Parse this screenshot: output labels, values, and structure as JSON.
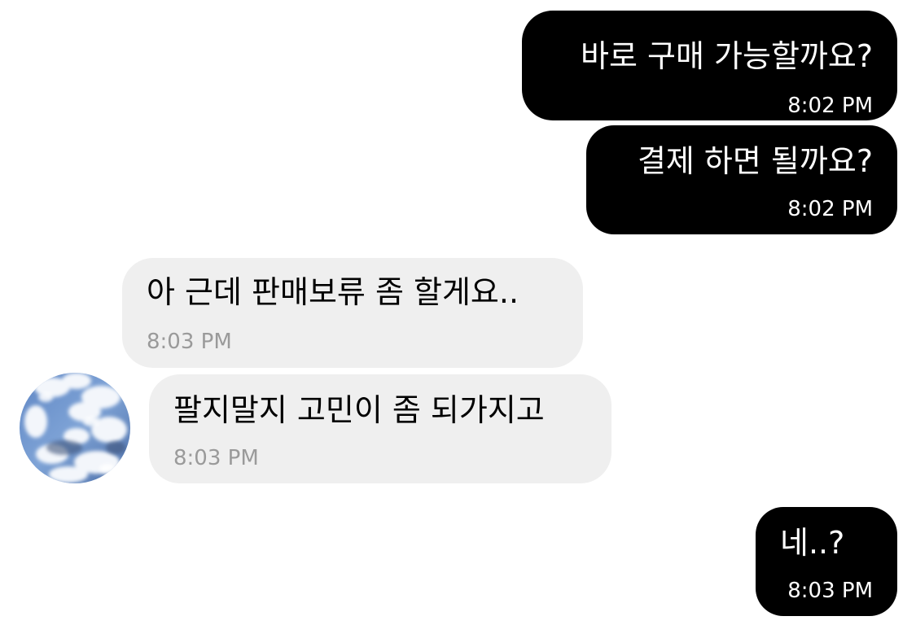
{
  "messages": [
    {
      "id": "m1",
      "direction": "sent",
      "text": "바로 구매 가능할까요?",
      "time": "8:02 PM"
    },
    {
      "id": "m2",
      "direction": "sent",
      "text": "결제 하면 될까요?",
      "time": "8:02 PM"
    },
    {
      "id": "m3",
      "direction": "received",
      "text": "아 근데 판매보류 좀 할게요..",
      "time": "8:03 PM"
    },
    {
      "id": "m4",
      "direction": "received",
      "text": "팔지말지 고민이 좀 되가지고",
      "time": "8:03 PM"
    },
    {
      "id": "m5",
      "direction": "sent",
      "text": "네..?",
      "time": "8:03 PM"
    }
  ],
  "avatar": {
    "icon": "sky-clouds-avatar"
  },
  "colors": {
    "sent_bubble": "#000000",
    "sent_text": "#ffffff",
    "received_bubble": "#efefef",
    "received_text": "#000000",
    "received_time": "#9a9a9a",
    "background": "#ffffff"
  }
}
